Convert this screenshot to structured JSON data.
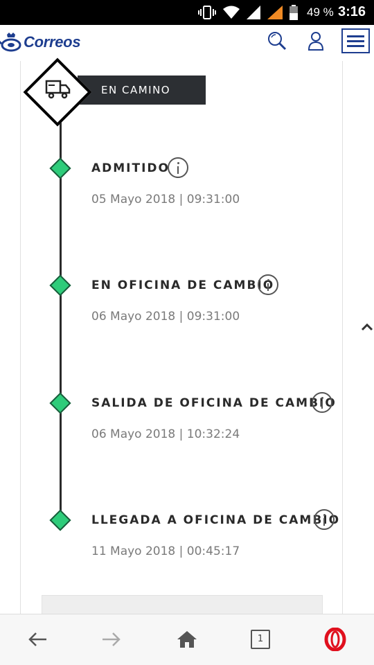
{
  "status_bar": {
    "battery": "49 %",
    "time": "3:16",
    "icons": [
      "vibrate-icon",
      "wifi-icon",
      "signal-icon",
      "signal-orange-icon",
      "battery-icon"
    ]
  },
  "header": {
    "brand": "Correos",
    "icons": [
      "search-icon",
      "user-icon",
      "menu-icon"
    ],
    "brand_color": "#1d3d8f"
  },
  "tracking": {
    "current_status": "EN CAMINO",
    "status_icon": "truck-icon",
    "events": [
      {
        "title": "ADMITIDO",
        "date": "05 Mayo 2018 | 09:31:00"
      },
      {
        "title": "EN OFICINA DE CAMBIO",
        "date": "06 Mayo 2018 | 09:31:00"
      },
      {
        "title": "SALIDA DE OFICINA DE CAMBIO",
        "date": "06 Mayo 2018 | 10:32:24"
      },
      {
        "title": "LLEGADA A OFICINA DE CAMBIO",
        "date": "11 Mayo 2018 | 00:45:17"
      }
    ],
    "accent_color": "#2ecc7a"
  },
  "browser_bar": {
    "tab_count": "1",
    "icons": [
      "back-arrow-icon",
      "forward-arrow-icon",
      "home-icon",
      "tabs-icon",
      "opera-icon"
    ]
  }
}
